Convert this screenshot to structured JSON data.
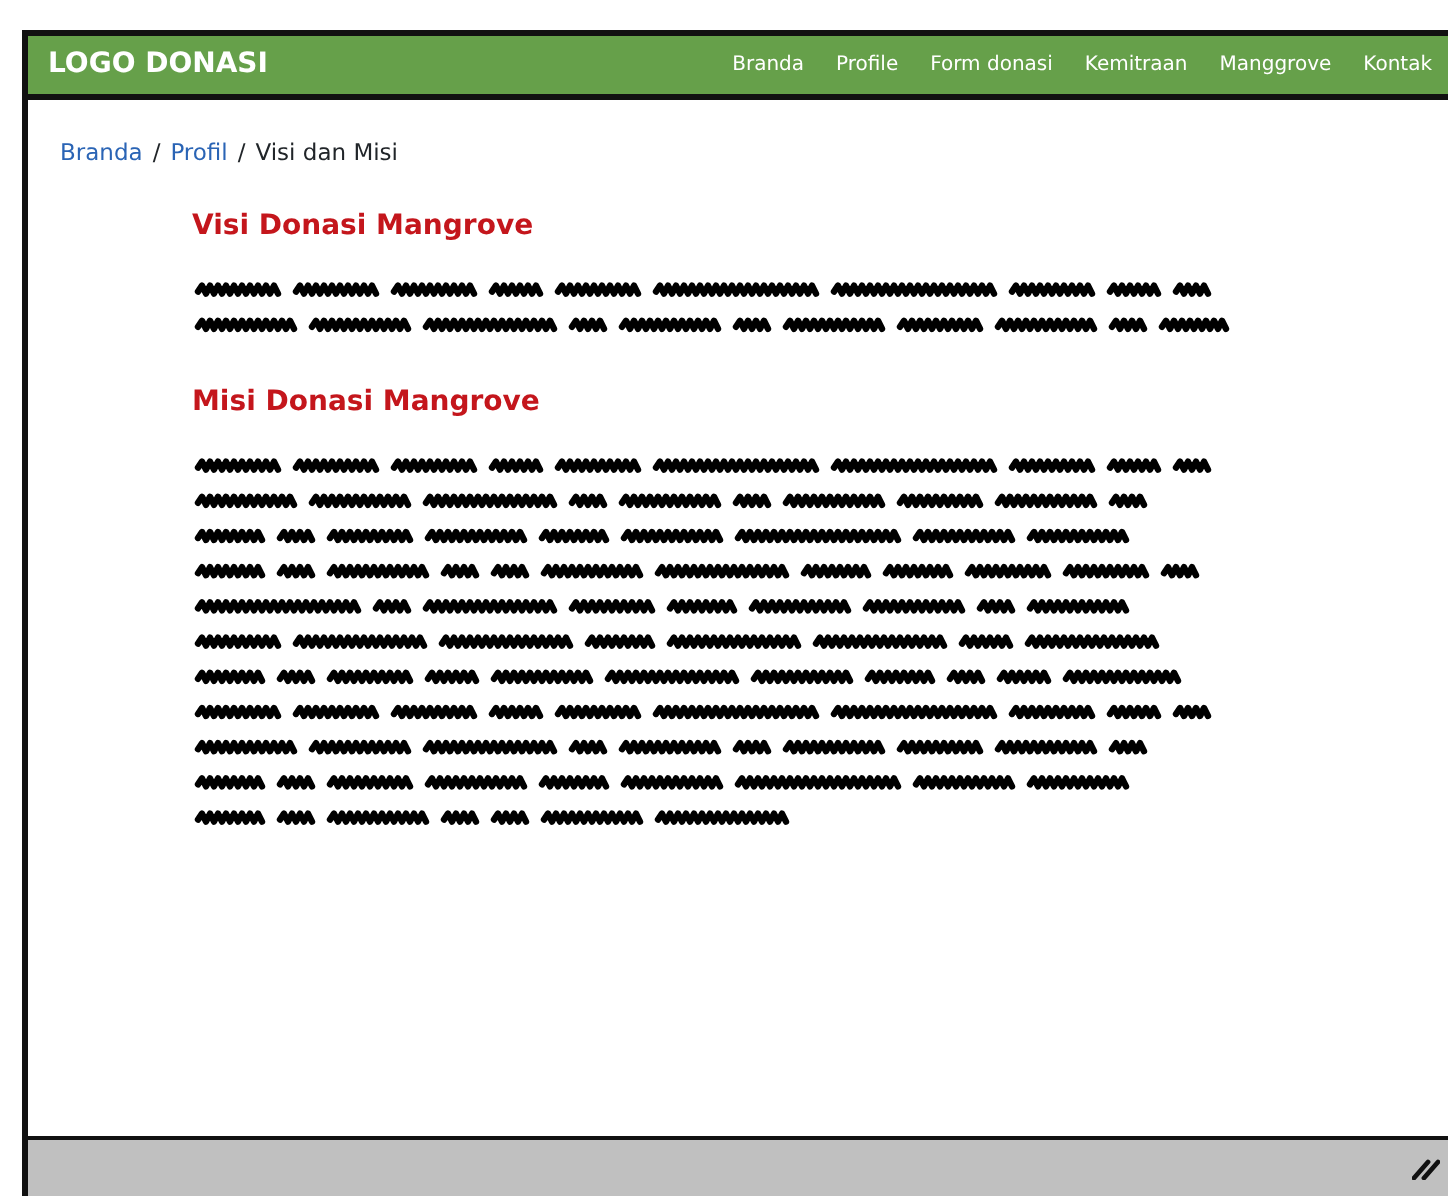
{
  "navbar": {
    "logo": "LOGO DONASI",
    "items": [
      {
        "label": "Branda"
      },
      {
        "label": "Profile"
      },
      {
        "label": "Form donasi"
      },
      {
        "label": "Kemitraan"
      },
      {
        "label": "Manggrove"
      },
      {
        "label": "Kontak"
      }
    ]
  },
  "breadcrumb": {
    "separator": "/",
    "items": [
      {
        "label": "Branda",
        "kind": "link"
      },
      {
        "label": "Profil",
        "kind": "link"
      },
      {
        "label": "Visi dan Misi",
        "kind": "current"
      }
    ]
  },
  "sections": [
    {
      "heading": "Visi Donasi Mangrove",
      "body": {
        "kind": "scribble"
      }
    },
    {
      "heading": "Misi Donasi Mangrove",
      "body": {
        "kind": "scribble"
      }
    }
  ],
  "status_bar": {
    "kind": "resize-grip"
  }
}
